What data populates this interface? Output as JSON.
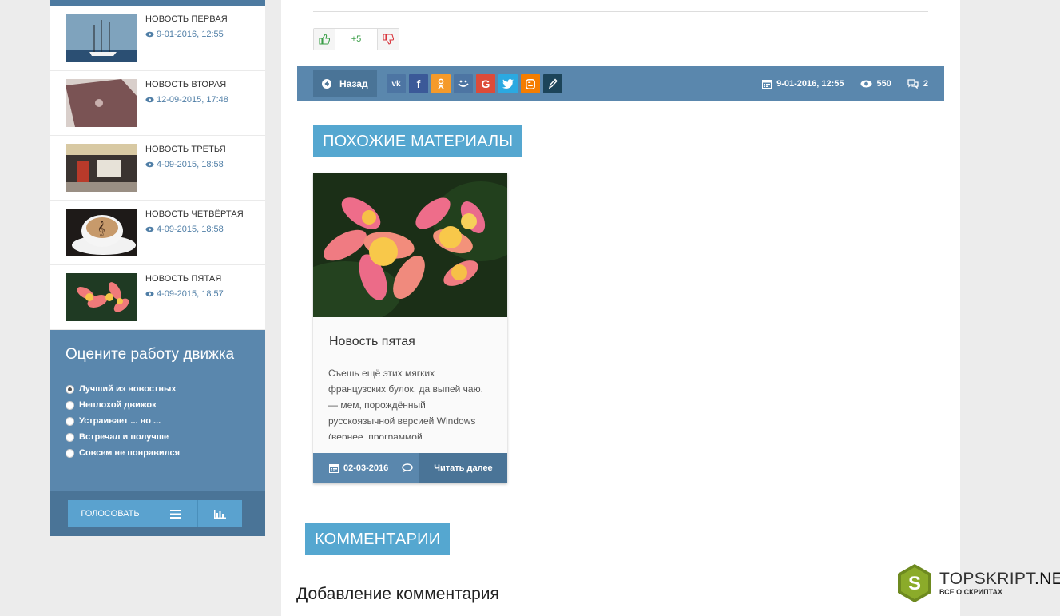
{
  "sidebar": {
    "news": [
      {
        "title": "НОВОСТЬ ПЕРВАЯ",
        "date": "9-01-2016, 12:55"
      },
      {
        "title": "НОВОСТЬ ВТОРАЯ",
        "date": "12-09-2015, 17:48"
      },
      {
        "title": "НОВОСТЬ ТРЕТЬЯ",
        "date": "4-09-2015, 18:58"
      },
      {
        "title": "НОВОСТЬ ЧЕТВЁРТАЯ",
        "date": "4-09-2015, 18:58"
      },
      {
        "title": "НОВОСТЬ ПЯТАЯ",
        "date": "4-09-2015, 18:57"
      }
    ],
    "poll": {
      "title": "Оцените работу движка",
      "options": [
        "Лучший из новостных",
        "Неплохой движок",
        "Устраивает ... но ...",
        "Встречал и получше",
        "Совсем не понравился"
      ],
      "vote_label": "ГОЛОСОВАТЬ"
    }
  },
  "article": {
    "rating": "+5",
    "back_label": "Назад",
    "socials": [
      "vk",
      "f",
      "ok",
      "mail",
      "G",
      "twitter",
      "blogger",
      "livejournal"
    ],
    "date": "9-01-2016, 12:55",
    "views": "550",
    "comments": "2"
  },
  "related": {
    "section_title": "ПОХОЖИЕ МАТЕРИАЛЫ",
    "card": {
      "title": "Новость пятая",
      "text": "Съешь ещё этих мягких французских булок, да выпей чаю. — мем, порождённый русскоязычной версией Windows (вернее, программой",
      "date": "02-03-2016",
      "read_more": "Читать далее"
    }
  },
  "comments": {
    "section_title": "КОММЕНТАРИИ",
    "add_title": "Добавление комментария"
  },
  "watermark": {
    "brand_a": "TOPSKRIPT",
    "brand_b": ".NET",
    "tagline": "ВСЕ О СКРИПТАХ"
  },
  "colors": {
    "bar": "#5a87ad",
    "accent": "#55a7d0",
    "dark": "#4a7497"
  }
}
